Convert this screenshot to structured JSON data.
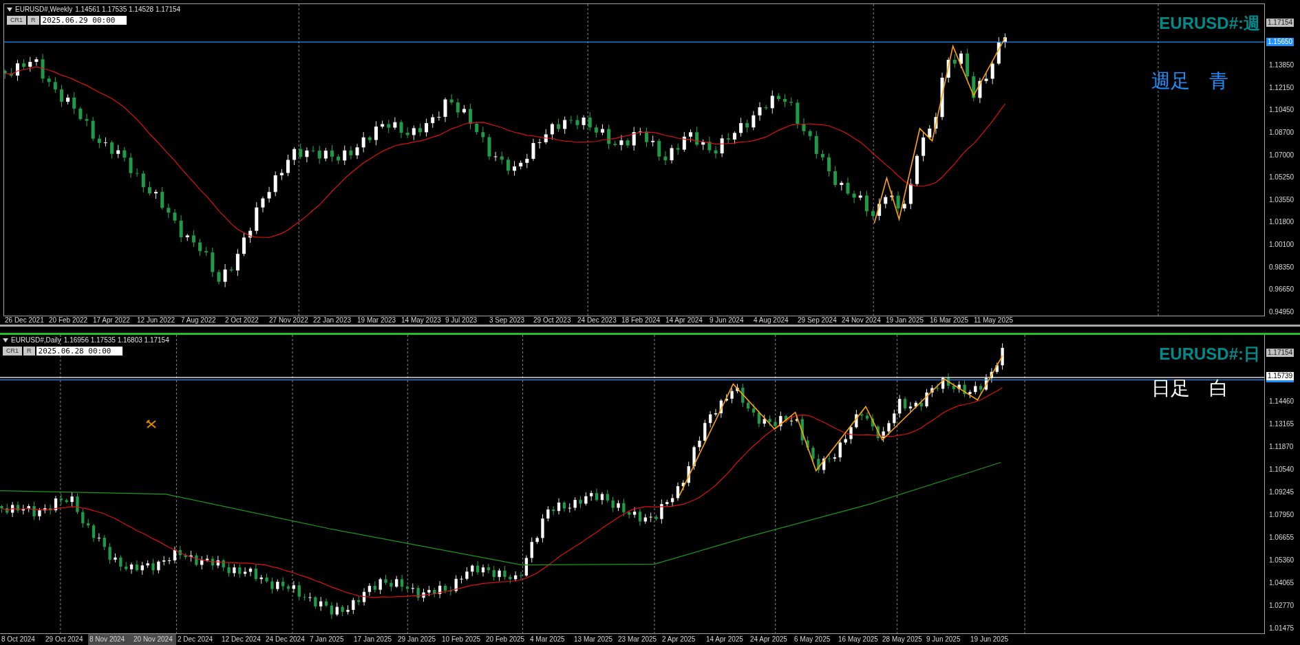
{
  "charts": [
    {
      "kind": "weekly",
      "header": {
        "symbol": "EURUSD#,Weekly",
        "ohlc": "1.14561 1.17535 1.14528 1.17154"
      },
      "buttons": [
        "CR1",
        "R"
      ],
      "date_field": "2025.06.29 00:00",
      "title": "EURUSD#:週",
      "note": {
        "text": "週足　青",
        "color": "#1e90ff"
      },
      "price_axis": [
        "1.13850",
        "1.12150",
        "1.10450",
        "1.08700",
        "1.07000",
        "1.05250",
        "1.03550",
        "1.01800",
        "1.00100",
        "0.98350",
        "0.96650",
        "0.94950"
      ],
      "price_markers": [
        {
          "label": "1.17154",
          "kind": "last"
        },
        {
          "label": "1.15650",
          "kind": "line"
        }
      ],
      "date_axis": [
        {
          "label": "26 Dec 2021",
          "highlighted": false
        },
        {
          "label": "20 Feb 2022",
          "highlighted": false
        },
        {
          "label": "17 Apr 2022",
          "highlighted": false
        },
        {
          "label": "12 Jun 2022",
          "highlighted": false
        },
        {
          "label": "7 Aug 2022",
          "highlighted": false
        },
        {
          "label": "2 Oct 2022",
          "highlighted": false
        },
        {
          "label": "27 Nov 2022",
          "highlighted": false
        },
        {
          "label": "22 Jan 2023",
          "highlighted": false
        },
        {
          "label": "19 Mar 2023",
          "highlighted": false
        },
        {
          "label": "14 May 2023",
          "highlighted": false
        },
        {
          "label": "9 Jul 2023",
          "highlighted": false
        },
        {
          "label": "3 Sep 2023",
          "highlighted": false
        },
        {
          "label": "29 Oct 2023",
          "highlighted": false
        },
        {
          "label": "24 Dec 2023",
          "highlighted": false
        },
        {
          "label": "18 Feb 2024",
          "highlighted": false
        },
        {
          "label": "14 Apr 2024",
          "highlighted": false
        },
        {
          "label": "9 Jun 2024",
          "highlighted": false
        },
        {
          "label": "4 Aug 2024",
          "highlighted": false
        },
        {
          "label": "29 Sep 2024",
          "highlighted": false
        },
        {
          "label": "24 Nov 2024",
          "highlighted": false
        },
        {
          "label": "19 Jan 2025",
          "highlighted": false
        },
        {
          "label": "16 Mar 2025",
          "highlighted": false
        },
        {
          "label": "11 May 2025",
          "highlighted": false
        }
      ]
    },
    {
      "kind": "daily",
      "header": {
        "symbol": "EURUSD#,Daily",
        "ohlc": "1.16956 1.17535 1.16803 1.17154"
      },
      "buttons": [
        "CR1",
        "R"
      ],
      "date_field": "2025.06.28 00:00",
      "title": "EURUSD#:日",
      "note": {
        "text": "日足　白",
        "color": "#ffffff"
      },
      "price_axis": [
        "1.14460",
        "1.13165",
        "1.11870",
        "1.10540",
        "1.09245",
        "1.07950",
        "1.06655",
        "1.05360",
        "1.04065",
        "1.02770",
        "1.01475"
      ],
      "price_markers": [
        {
          "label": "1.17154",
          "kind": "last"
        },
        {
          "label": "1.15739",
          "kind": "line_selected"
        }
      ],
      "date_axis": [
        {
          "label": "8 Oct 2024",
          "highlighted": false
        },
        {
          "label": "29 Oct 2024",
          "highlighted": false
        },
        {
          "label": "8 Nov 2024",
          "highlighted": true
        },
        {
          "label": "20 Nov 2024",
          "highlighted": true
        },
        {
          "label": "2 Dec 2024",
          "highlighted": false
        },
        {
          "label": "12 Dec 2024",
          "highlighted": false
        },
        {
          "label": "24 Dec 2024",
          "highlighted": false
        },
        {
          "label": "7 Jan 2025",
          "highlighted": false
        },
        {
          "label": "17 Jan 2025",
          "highlighted": false
        },
        {
          "label": "29 Jan 2025",
          "highlighted": false
        },
        {
          "label": "10 Feb 2025",
          "highlighted": false
        },
        {
          "label": "20 Feb 2025",
          "highlighted": false
        },
        {
          "label": "4 Mar 2025",
          "highlighted": false
        },
        {
          "label": "13 Mar 2025",
          "highlighted": false
        },
        {
          "label": "23 Mar 2025",
          "highlighted": false
        },
        {
          "label": "2 Apr 2025",
          "highlighted": false
        },
        {
          "label": "14 Apr 2025",
          "highlighted": false
        },
        {
          "label": "24 Apr 2025",
          "highlighted": false
        },
        {
          "label": "6 May 2025",
          "highlighted": false
        },
        {
          "label": "16 May 2025",
          "highlighted": false
        },
        {
          "label": "28 May 2025",
          "highlighted": false
        },
        {
          "label": "9 Jun 2025",
          "highlighted": false
        },
        {
          "label": "19 Jun 2025",
          "highlighted": false
        }
      ]
    }
  ]
}
